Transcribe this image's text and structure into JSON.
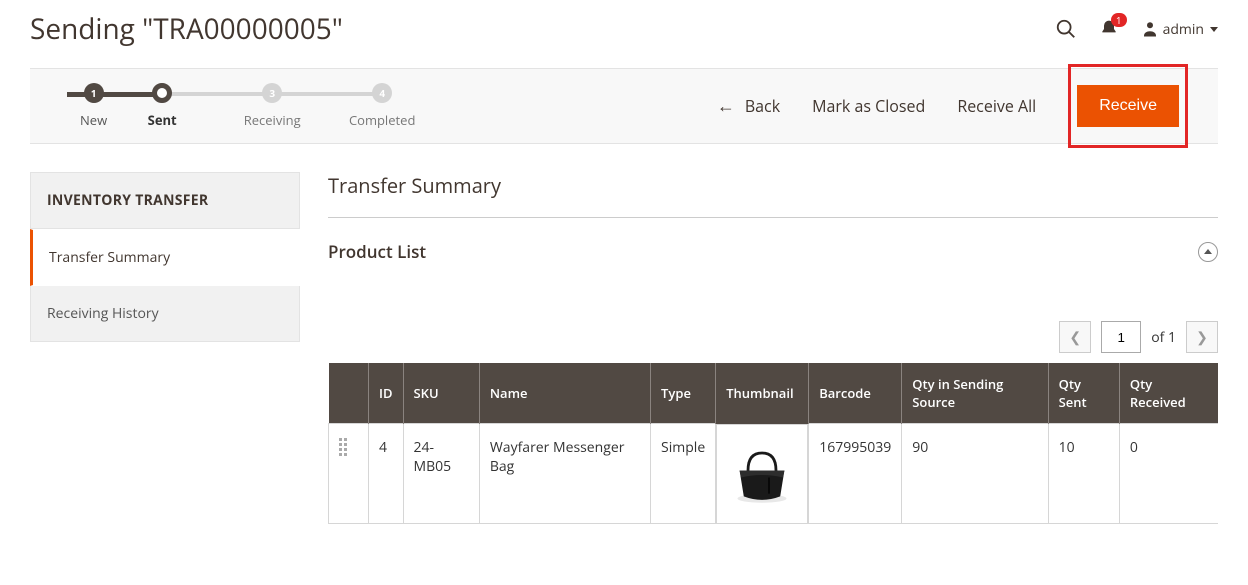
{
  "header": {
    "title": "Sending \"TRA00000005\"",
    "notification_count": "1",
    "admin_label": "admin"
  },
  "steps": [
    {
      "num": "1",
      "label": "New",
      "state": "done"
    },
    {
      "num": "",
      "label": "Sent",
      "state": "current"
    },
    {
      "num": "3",
      "label": "Receiving",
      "state": "future"
    },
    {
      "num": "4",
      "label": "Completed",
      "state": "future"
    }
  ],
  "actions": {
    "back": "Back",
    "mark_closed": "Mark as Closed",
    "receive_all": "Receive All",
    "receive": "Receive"
  },
  "sidebar": {
    "header": "INVENTORY TRANSFER",
    "items": [
      {
        "label": "Transfer Summary",
        "active": true
      },
      {
        "label": "Receiving History",
        "active": false
      }
    ]
  },
  "content": {
    "section_title": "Transfer Summary",
    "subsection_title": "Product List"
  },
  "pagination": {
    "current": "1",
    "total_label": "of 1"
  },
  "table": {
    "columns": [
      "",
      "ID",
      "SKU",
      "Name",
      "Type",
      "Thumbnail",
      "Barcode",
      "Qty in Sending Source",
      "Qty Sent",
      "Qty Received"
    ],
    "rows": [
      {
        "id": "4",
        "sku": "24-MB05",
        "name": "Wayfarer Messenger Bag",
        "type": "Simple",
        "barcode": "167995039",
        "qty_src": "90",
        "qty_sent": "10",
        "qty_recv": "0"
      }
    ]
  }
}
